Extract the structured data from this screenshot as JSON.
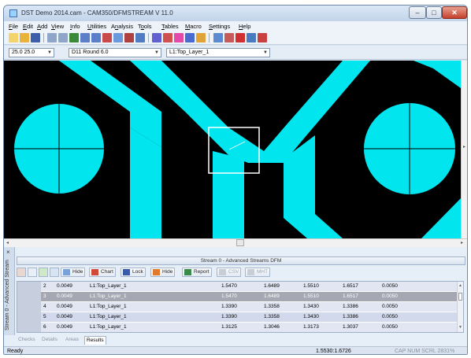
{
  "window": {
    "title": "DST Demo 2014.cam - CAM350/DFMSTREAM V 11.0",
    "controls": {
      "minimize": "–",
      "maximize": "□",
      "close": "✕"
    }
  },
  "menu": [
    {
      "label": "File",
      "key": "F"
    },
    {
      "label": "Edit",
      "key": "E"
    },
    {
      "label": "Add",
      "key": "A"
    },
    {
      "label": "View",
      "key": "V"
    },
    {
      "label": "Info",
      "key": "I"
    },
    {
      "label": "Utilities",
      "key": "U"
    },
    {
      "label": "Analysis",
      "key": "n"
    },
    {
      "label": "Tools",
      "key": "o"
    },
    {
      "label": "Tables",
      "key": "T"
    },
    {
      "label": "Macro",
      "key": "M"
    },
    {
      "label": "Settings",
      "key": "S"
    },
    {
      "label": "Help",
      "key": "H"
    }
  ],
  "selection_bar": {
    "grid": "25.0 25.0",
    "dcode": "D11  Round 6.0",
    "layer": "L1:Top_Layer_1"
  },
  "colors": {
    "copper": "#00e5ee",
    "background": "#000000",
    "selection_box": "#ffffff",
    "selected_row": "#a5a8b2"
  },
  "panel": {
    "side_label": "Stream 0 - Advanced Stream",
    "close": "×",
    "header": "Stream 0 - Advanced Streams DFM",
    "toolbar": {
      "hide1": "Hide",
      "chart": "Chart",
      "lock": "Lock",
      "hide2": "Hide",
      "report": "Report",
      "csv": "CSV",
      "mht": "MHT"
    },
    "rows": [
      {
        "id": "2",
        "v1": "0.0049",
        "layer": "L1:Top_Layer_1",
        "a": "1.5470",
        "b": "1.6489",
        "c": "1.5510",
        "d": "1.6517",
        "e": "0.0050",
        "selected": false
      },
      {
        "id": "3",
        "v1": "0.0049",
        "layer": "L1:Top_Layer_1",
        "a": "1.5470",
        "b": "1.6489",
        "c": "1.5510",
        "d": "1.6517",
        "e": "0.0050",
        "selected": true
      },
      {
        "id": "4",
        "v1": "0.0049",
        "layer": "L1:Top_Layer_1",
        "a": "1.3390",
        "b": "1.3358",
        "c": "1.3430",
        "d": "1.3386",
        "e": "0.0050",
        "selected": false
      },
      {
        "id": "5",
        "v1": "0.0049",
        "layer": "L1:Top_Layer_1",
        "a": "1.3390",
        "b": "1.3358",
        "c": "1.3430",
        "d": "1.3386",
        "e": "0.0050",
        "selected": false
      },
      {
        "id": "6",
        "v1": "0.0049",
        "layer": "L1:Top_Layer_1",
        "a": "1.3125",
        "b": "1.3046",
        "c": "1.3173",
        "d": "1.3037",
        "e": "0.0050",
        "selected": false
      }
    ],
    "tabs": [
      {
        "label": "Checks",
        "active": false
      },
      {
        "label": "Details",
        "active": false
      },
      {
        "label": "Areas",
        "active": false
      },
      {
        "label": "Results",
        "active": true
      }
    ]
  },
  "status": {
    "ready": "Ready",
    "coords": "1.5530:1.6726",
    "keys": "CAP  NUM  SCRL   2831%"
  }
}
